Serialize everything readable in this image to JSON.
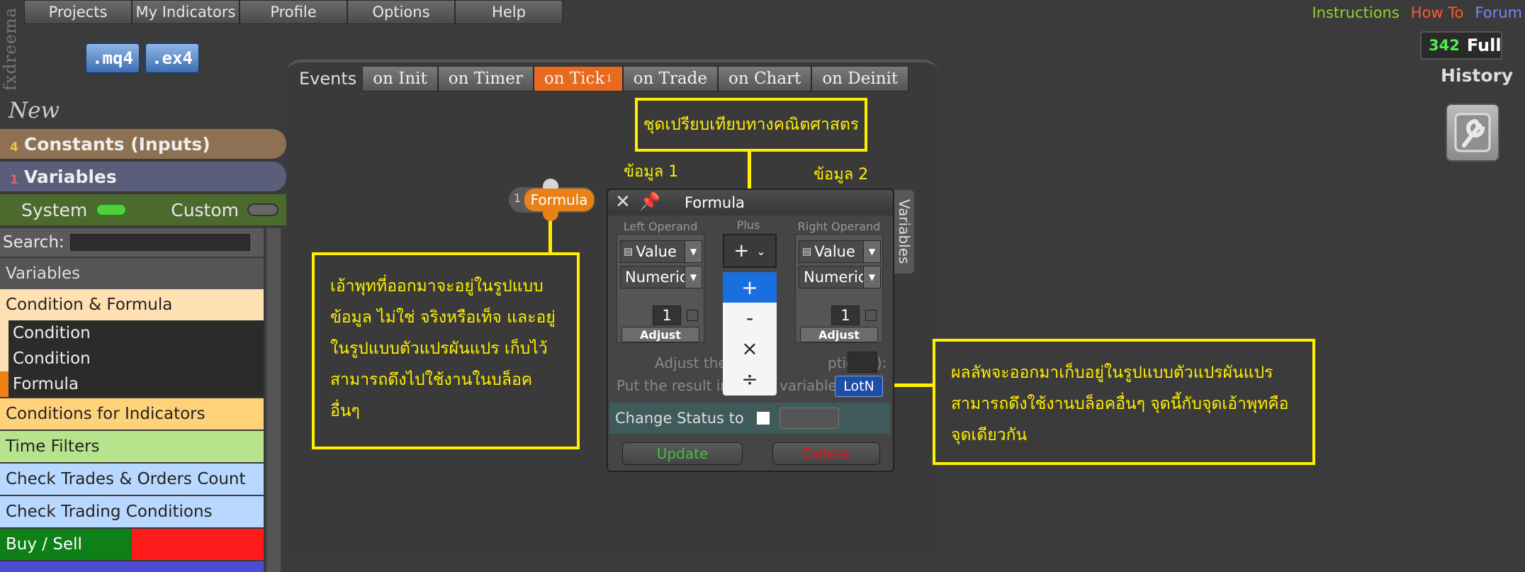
{
  "menu": [
    "Projects",
    "My Indicators",
    "Profile",
    "Options",
    "Help"
  ],
  "brand": "fxdreema",
  "files": {
    "mq4": ".mq4",
    "ex4": ".ex4"
  },
  "links": {
    "instructions": {
      "label": "Instructions",
      "color": "#8bd62b"
    },
    "howto": {
      "label": "How To",
      "color": "#ff5a2c"
    },
    "forum": {
      "label": "Forum",
      "color": "#7b82ff"
    }
  },
  "counter": {
    "value": "342",
    "full": "Full"
  },
  "history": "History",
  "left": {
    "new": "New",
    "constants": {
      "count": "4",
      "label": "Constants (Inputs)",
      "color": "#8e7052"
    },
    "variables": {
      "count": "1",
      "label": "Variables",
      "color": "#5a5e7a"
    },
    "system": "System",
    "custom": "Custom",
    "search_label": "Search:",
    "categories": {
      "variables": "Variables",
      "cond_formula": "Condition & Formula",
      "sub1": "Condition",
      "sub2": "Condition",
      "sub3": "Formula",
      "cond_ind": "Conditions for Indicators",
      "time": "Time Filters",
      "check_trades": "Check Trades & Orders Count",
      "check_cond": "Check Trading Conditions",
      "buysell": "Buy / Sell"
    }
  },
  "tabs": {
    "events": "Events",
    "items": [
      "on Init",
      "on Timer",
      "on Tick",
      "on Trade",
      "on Chart",
      "on Deinit"
    ],
    "active_sub": "1"
  },
  "annotations": {
    "top": "ชุดเปรียบเทียบทางคณิตศาสตร",
    "data1": "ข้อมูล 1",
    "data2": "ข้อมูล 2",
    "left": [
      "เอ้าพุทที่ออกมาจะอยู่ในรูปแบบ",
      "ข้อมูล ไม่ใช่ จริงหรือเท็จ และอยู่",
      "ในรูปแบบตัวแปรผันแปร เก็บไว้",
      "สามารถดึงไปใช้งานในบล็อค",
      "อื่นๆ"
    ],
    "right": [
      "ผลลัพจะออกมาเก็บอยู่ในรูปแบบตัวแปรผันแปร",
      "สามารถดึงใช้งานบล็อคอื่นๆ จุดนี้กับจุดเอ้าพุทคือ",
      "จุดเดียวกัน"
    ]
  },
  "node": {
    "num": "1",
    "label": "Formula"
  },
  "dialog": {
    "title": "Formula",
    "variables_tab": "Variables",
    "left_caption": "Left Operand",
    "right_caption": "Right Operand",
    "plus_caption": "Plus",
    "value": "Value",
    "numeric": "Numeric",
    "left_num": "1",
    "right_num": "1",
    "adjust": "Adjust",
    "operator": "+",
    "ops": [
      "+",
      "-",
      "×",
      "÷"
    ],
    "adjust_row": "Adjust the",
    "adjust_row_tail": "ptional):",
    "result_row": "Put the result in",
    "result_row_tail": "variable:",
    "result_var": "LotN",
    "status": "Change Status to",
    "update": "Update",
    "delete": "Delete"
  }
}
